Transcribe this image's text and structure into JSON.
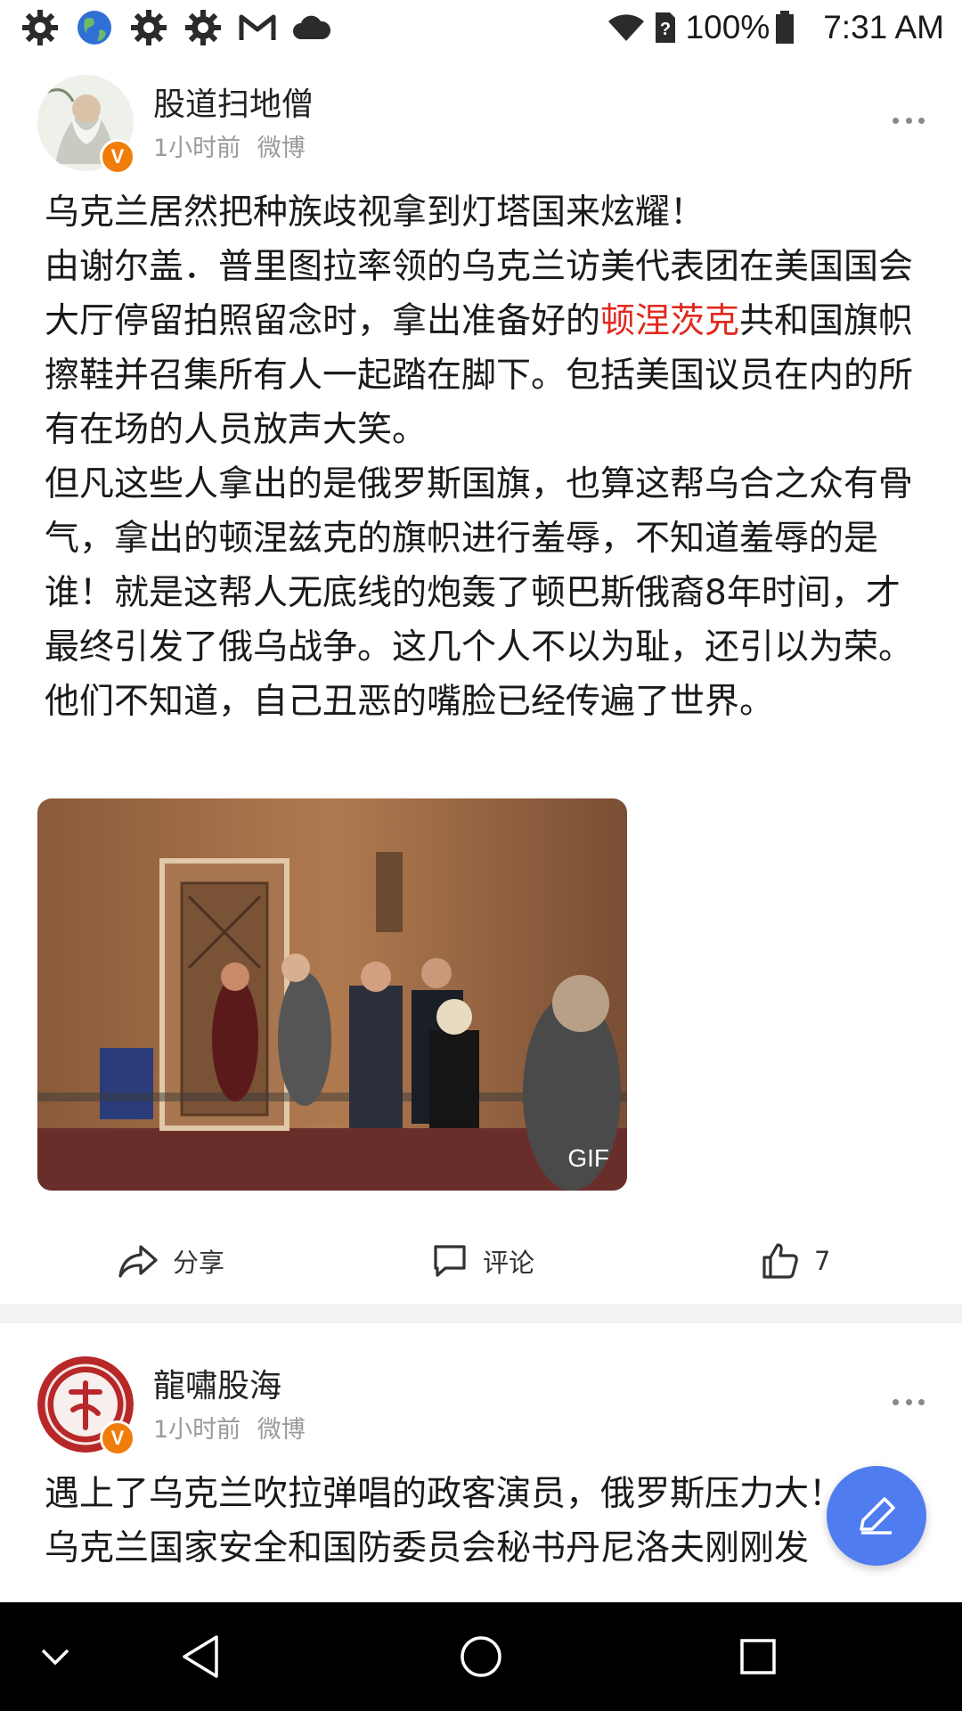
{
  "status_bar": {
    "notification_icons": [
      "settings-gear-icon",
      "globe-icon",
      "settings-gear-icon",
      "settings-gear-icon",
      "gmail-icon",
      "cloud-icon"
    ],
    "battery": "100%",
    "time": "7:31 AM"
  },
  "posts": [
    {
      "author": "股道扫地僧",
      "time": "1小时前",
      "source": "微博",
      "text_before": "乌克兰居然把种族歧视拿到灯塔国来炫耀！\n由谢尔盖．普里图拉率领的乌克兰访美代表团在美国国会大厅停留拍照留念时，拿出准备好的",
      "link_text": "顿涅茨克",
      "text_after": "共和国旗帜擦鞋并召集所有人一起踏在脚下。包括美国议员在内的所有在场的人员放声大笑。\n但凡这些人拿出的是俄罗斯国旗，也算这帮乌合之众有骨气，拿出的顿涅兹克的旗帜进行羞辱，不知道羞辱的是谁！就是这帮人无底线的炮轰了顿巴斯俄裔8年时间，才最终引发了俄乌战争。这几个人不以为耻，还引以为荣。他们不知道，自己丑恶的嘴脸已经传遍了世界。",
      "media_label": "GIF",
      "share_label": "分享",
      "comment_label": "评论",
      "like_count": "7"
    },
    {
      "author": "龍嘯股海",
      "time": "1小时前",
      "source": "微博",
      "text": "遇上了乌克兰吹拉弹唱的政客演员，俄罗斯压力大！\n乌克兰国家安全和国防委员会秘书丹尼洛夫刚刚发"
    }
  ],
  "colors": {
    "accent_red": "#e2281f",
    "fab_blue": "#4f7df0",
    "verified_orange": "#f07d0a"
  }
}
